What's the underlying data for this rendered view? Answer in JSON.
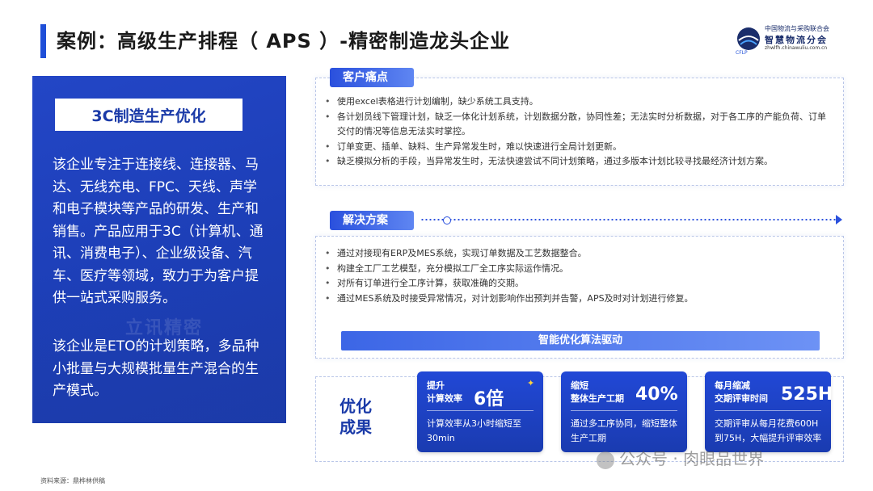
{
  "title": "案例：高级生产排程（ APS ）-精密制造龙头企业",
  "logo": {
    "org_line1": "中国物流与采购联合会",
    "org_line2": "智慧物流分会",
    "org_line3": "zhwlfh.chinawuliu.com.cn",
    "abbr": "CFLP"
  },
  "left_panel": {
    "heading": "3C制造生产优化",
    "para1": "该企业专注于连接线、连接器、马达、无线充电、FPC、天线、声学和电子模块等产品的研发、生产和销售。产品应用于3C（计算机、通讯、消费电子）、企业级设备、汽车、医疗等领域，致力于为客户提供一站式采购服务。",
    "para2": "该企业是ETO的计划策略，多品种小批量与大规模批量生产混合的生产模式。",
    "watermark": "立讯精密"
  },
  "pain_points": {
    "tag": "客户痛点",
    "items": [
      "使用excel表格进行计划编制，缺少系统工具支持。",
      "各计划员线下管理计划，缺乏一体化计划系统，计划数据分散，协同性差；无法实时分析数据，对于各工序的产能负荷、订单交付的情况等信息无法实时掌控。",
      "订单变更、插单、缺料、生产异常发生时，难以快速进行全局计划更新。",
      "缺乏模拟分析的手段，当异常发生时，无法快速尝试不同计划策略，通过多版本计划比较寻找最经济计划方案。"
    ]
  },
  "solution": {
    "tag": "解决方案",
    "items": [
      "通过对接现有ERP及MES系统，实现订单数据及工艺数据整合。",
      "构建全工厂工艺模型，充分模拟工厂全工序实际运作情况。",
      "对所有订单进行全工序计算，获取准确的交期。",
      "通过MES系统及时接受异常情况，对计划影响作出预判并告警，APS及时对计划进行修复。"
    ],
    "algo_bar": "智能优化算法驱动"
  },
  "results": {
    "label_line1": "优化",
    "label_line2": "成果",
    "cards": [
      {
        "head1": "提升",
        "head2": "计算效率",
        "big": "6倍",
        "desc": "计算效率从3小时缩短至30min"
      },
      {
        "head1": "缩短",
        "head2": "整体生产工期",
        "big": "40%",
        "desc": "通过多工序协同，缩短整体生产工期"
      },
      {
        "head1": "每月缩减",
        "head2": "交期评审时间",
        "big": "525H",
        "desc": "交期评审从每月花费600H到75H，大幅提升评审效率"
      }
    ]
  },
  "watermark_text": "公众号 · 肉眼品世界",
  "source": "资料来源：鼎桦林供稿"
}
